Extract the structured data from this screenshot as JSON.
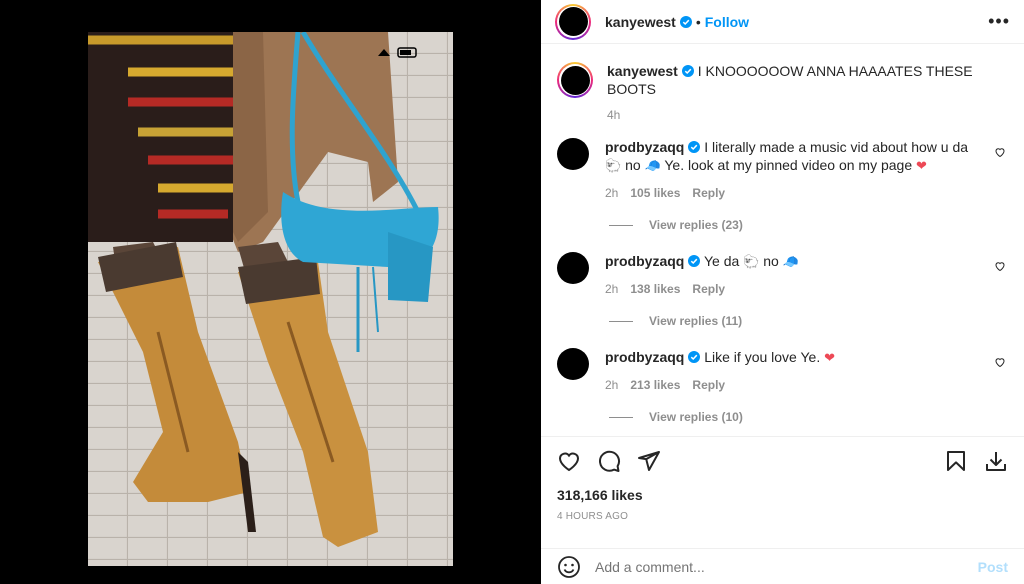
{
  "post": {
    "author": "kanyewest",
    "follow_label": "Follow",
    "separator": "•",
    "more_label": "•••"
  },
  "caption": {
    "username": "kanyewest",
    "text": "I KNOOOOOOW ANNA HAAAATES THESE BOOTS",
    "time": "4h"
  },
  "comments": [
    {
      "username": "prodbyzaqq",
      "text_a": "I literally made a music vid about how u da ",
      "emoji_1": "🐑",
      "text_b": " no ",
      "emoji_2": "🧢",
      "text_c": " Ye. look at my pinned video on my page ",
      "emoji_3": "❤",
      "time": "2h",
      "likes": "105 likes",
      "reply": "Reply",
      "view_replies": "View replies (23)"
    },
    {
      "username": "prodbyzaqq",
      "text_a": "Ye da ",
      "emoji_1": "🐑",
      "text_b": " no ",
      "emoji_2": "🧢",
      "time": "2h",
      "likes": "138 likes",
      "reply": "Reply",
      "view_replies": "View replies (11)"
    },
    {
      "username": "prodbyzaqq",
      "text_a": "Like if you love Ye. ",
      "emoji_1": "❤",
      "time": "2h",
      "likes": "213 likes",
      "reply": "Reply",
      "view_replies": "View replies (10)"
    }
  ],
  "footer": {
    "likes": "318,166 likes",
    "time": "4 HOURS AGO",
    "comment_placeholder": "Add a comment...",
    "post_label": "Post"
  },
  "colors": {
    "accent": "#0095f6",
    "verified": "#0095f6",
    "heart": "#ed4956",
    "post_disabled": "#b2dffc"
  }
}
